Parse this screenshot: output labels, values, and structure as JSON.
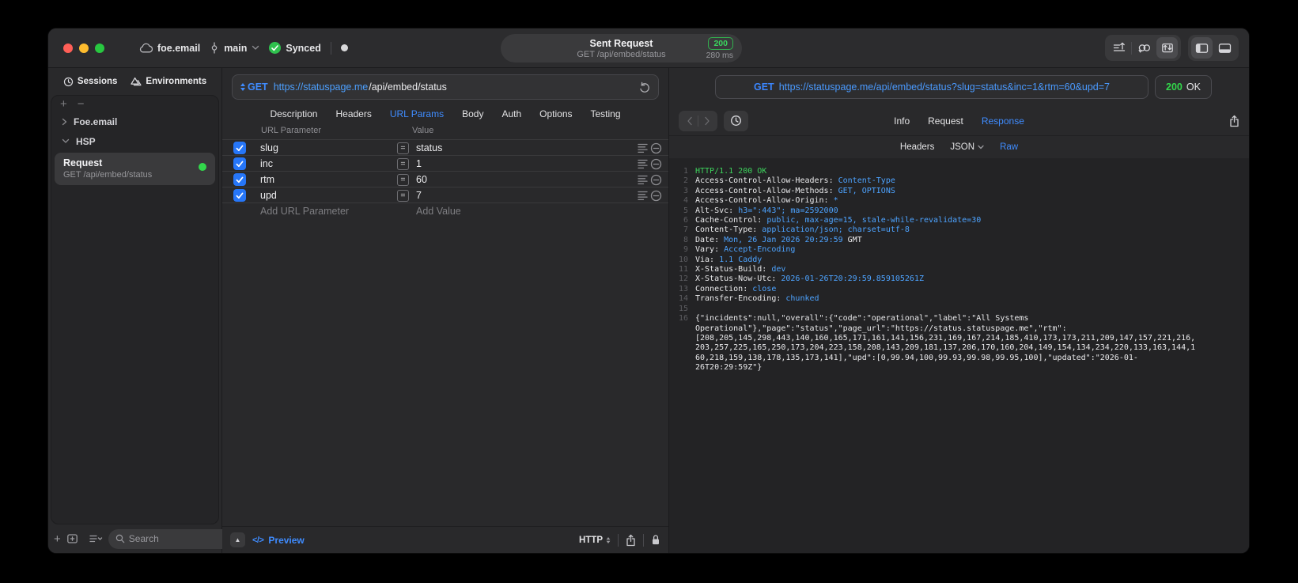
{
  "titlebar": {
    "project": "foe.email",
    "branch": "main",
    "sync_label": "Synced",
    "request_title": "Sent Request",
    "request_subtitle": "GET /api/embed/status",
    "status_code": "200",
    "duration": "280 ms"
  },
  "sidebar": {
    "tab_sessions": "Sessions",
    "tab_environments": "Environments",
    "group_top": "Foe.email",
    "group_expanded": "HSP",
    "request_name": "Request",
    "request_detail": "GET /api/embed/status",
    "search_placeholder": "Search"
  },
  "request": {
    "method": "GET",
    "url_host": "https://statuspage.me",
    "url_path": "/api/embed/status",
    "tabs": [
      "Description",
      "Headers",
      "URL Params",
      "Body",
      "Auth",
      "Options",
      "Testing"
    ],
    "active_tab": "URL Params",
    "param_column": "URL Parameter",
    "value_column": "Value",
    "params": [
      {
        "name": "slug",
        "value": "status",
        "checked": true
      },
      {
        "name": "inc",
        "value": "1",
        "checked": true
      },
      {
        "name": "rtm",
        "value": "60",
        "checked": true
      },
      {
        "name": "upd",
        "value": "7",
        "checked": true
      }
    ],
    "add_param_label": "Add URL Parameter",
    "add_value_label": "Add Value",
    "code_glyph": "</>",
    "preview_label": "Preview",
    "protocol": "HTTP"
  },
  "response": {
    "method": "GET",
    "url": "https://statuspage.me/api/embed/status?slug=status&inc=1&rtm=60&upd=7",
    "status_code": "200",
    "status_text": "OK",
    "tabs": [
      "Info",
      "Request",
      "Response"
    ],
    "active_tab": "Response",
    "subtabs": [
      "Headers",
      "JSON",
      "Raw"
    ],
    "active_subtab": "Raw",
    "body_lines": [
      {
        "parts": [
          {
            "text": "HTTP/1.1 200 OK",
            "color": "green"
          }
        ]
      },
      {
        "parts": [
          {
            "text": "Access-Control-Allow-Headers: ",
            "color": "plain"
          },
          {
            "text": "Content-Type",
            "color": "blue"
          }
        ]
      },
      {
        "parts": [
          {
            "text": "Access-Control-Allow-Methods: ",
            "color": "plain"
          },
          {
            "text": "GET, OPTIONS",
            "color": "blue"
          }
        ]
      },
      {
        "parts": [
          {
            "text": "Access-Control-Allow-Origin: ",
            "color": "plain"
          },
          {
            "text": "*",
            "color": "blue"
          }
        ]
      },
      {
        "parts": [
          {
            "text": "Alt-Svc: ",
            "color": "plain"
          },
          {
            "text": "h3=\":443\"; ma=2592000",
            "color": "blue"
          }
        ]
      },
      {
        "parts": [
          {
            "text": "Cache-Control: ",
            "color": "plain"
          },
          {
            "text": "public, max-age=15, stale-while-revalidate=30",
            "color": "blue"
          }
        ]
      },
      {
        "parts": [
          {
            "text": "Content-Type: ",
            "color": "plain"
          },
          {
            "text": "application/json; charset=utf-8",
            "color": "blue"
          }
        ]
      },
      {
        "parts": [
          {
            "text": "Date: ",
            "color": "plain"
          },
          {
            "text": "Mon, 26 Jan 2026 20:29:59",
            "color": "blue"
          },
          {
            "text": " GMT",
            "color": "plain"
          }
        ]
      },
      {
        "parts": [
          {
            "text": "Vary: ",
            "color": "plain"
          },
          {
            "text": "Accept-Encoding",
            "color": "blue"
          }
        ]
      },
      {
        "parts": [
          {
            "text": "Via: ",
            "color": "plain"
          },
          {
            "text": "1.1 Caddy",
            "color": "blue"
          }
        ]
      },
      {
        "parts": [
          {
            "text": "X-Status-Build: ",
            "color": "plain"
          },
          {
            "text": "dev",
            "color": "blue"
          }
        ]
      },
      {
        "parts": [
          {
            "text": "X-Status-Now-Utc: ",
            "color": "plain"
          },
          {
            "text": "2026-01-26T20:29:59.859105261Z",
            "color": "blue"
          }
        ]
      },
      {
        "parts": [
          {
            "text": "Connection: ",
            "color": "plain"
          },
          {
            "text": "close",
            "color": "blue"
          }
        ]
      },
      {
        "parts": [
          {
            "text": "Transfer-Encoding: ",
            "color": "plain"
          },
          {
            "text": "chunked",
            "color": "blue"
          }
        ]
      },
      {
        "parts": []
      },
      {
        "parts": [
          {
            "text": "{\"incidents\":null,\"overall\":{\"code\":\"operational\",\"label\":\"All Systems Operational\"},\"page\":\"status\",\"page_url\":\"https://status.statuspage.me\",\"rtm\":[208,205,145,298,443,140,160,165,171,161,141,156,231,169,167,214,185,410,173,173,211,209,147,157,221,216,203,257,225,165,250,173,204,223,158,208,143,209,181,137,206,170,160,204,149,154,134,234,220,133,163,144,160,218,159,138,178,135,173,141],\"upd\":[0,99.94,100,99.93,99.98,99.95,100],\"updated\":\"2026-01-26T20:29:59Z\"}",
            "color": "plain"
          }
        ]
      }
    ]
  },
  "icons": {
    "cloud-icon": "cloud outline",
    "branch-icon": "git commit node",
    "synced-check-icon": "green check circle",
    "sort-import-icon": "lines with up arrow",
    "loop-icon": "linked loops",
    "sync-box-icon": "box with up/down arrows",
    "panel-left-icon": "left sidebar layout",
    "panel-bottom-icon": "bottom panel layout",
    "history-clock-icon": "clock",
    "environments-icon": "stacked triangles",
    "search-icon": "magnifier",
    "refresh-icon": "circular arrow",
    "equals-icon": "boxed equals",
    "row-options-icon": "hamburger lines",
    "remove-row-icon": "minus in circle",
    "share-icon": "square with up arrow",
    "lock-icon": "closed padlock"
  },
  "colors": {
    "accent_blue": "#3f8cff",
    "value_blue": "#4da3ff",
    "green": "#32d74b",
    "window_bg": "#29292b"
  }
}
